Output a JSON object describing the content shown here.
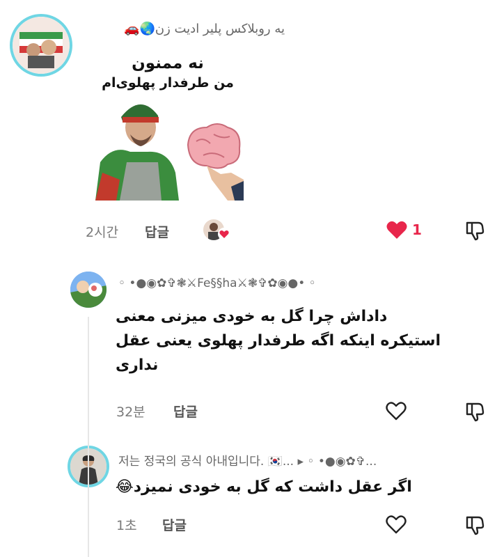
{
  "comments": [
    {
      "username": "یه روبلاکس پلیر ادیت زن🌏🚗",
      "sticker": {
        "line1": "نه ممنون",
        "line2": "من طرفدار پهلوی‌ام"
      },
      "time": "2시간",
      "reply_label": "답글",
      "like_count": "1"
    },
    {
      "username": "◦ •●◉✿✞❃⚔Fe§§ha⚔❃✞✿◉●• ◦",
      "text_line1": "داداش چرا گل به خودی میزنی معنی",
      "text_line2": "استیکره اینکه اگه طرفدار پهلوی یعنی عقل",
      "text_line3": "نداری",
      "time": "32분",
      "reply_label": "답글"
    },
    {
      "username": "저는 정국의 공식 아내입니다. 🇰🇷... ▸ ◦ •●◉✿✞...",
      "text": "اگر عقل داشت که گل به خودی نمیزد😂",
      "time": "1초",
      "reply_label": "답글"
    }
  ],
  "colors": {
    "ring": "#6fd6e4",
    "like": "#e8264b",
    "muted": "#7a7a7a"
  }
}
